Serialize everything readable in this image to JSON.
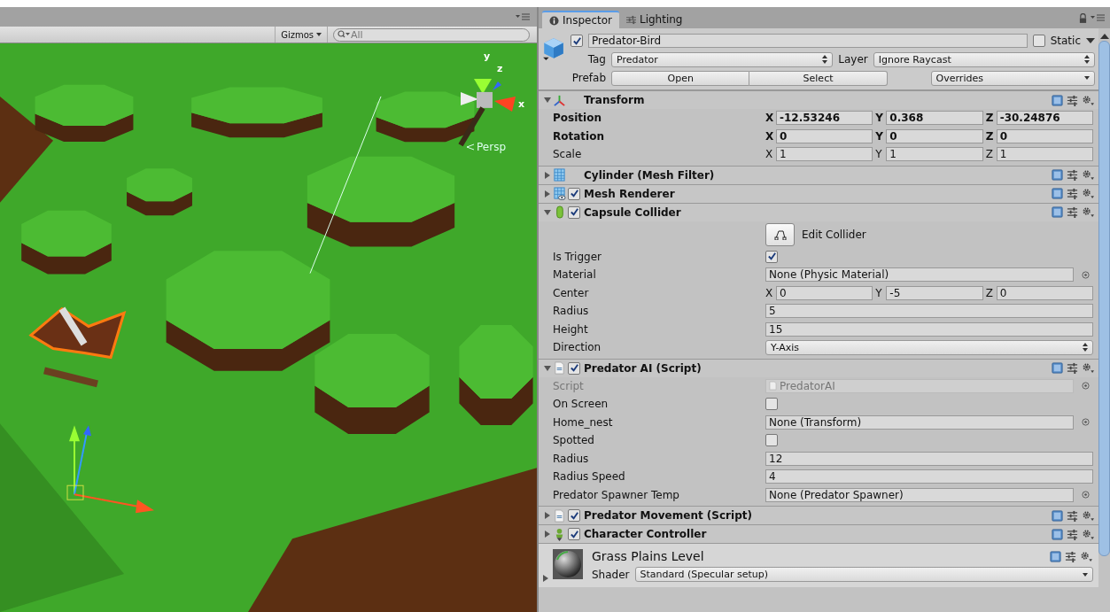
{
  "scene": {
    "gizmos_label": "Gizmos",
    "search_value": "All",
    "axis_labels": [
      "y",
      "z",
      "x"
    ],
    "projection": "Persp"
  },
  "inspector": {
    "tabs": [
      {
        "label": "Inspector",
        "selected": true
      },
      {
        "label": "Lighting",
        "selected": false
      }
    ]
  },
  "object": {
    "active": true,
    "name": "Predator-Bird",
    "static": false,
    "static_label": "Static",
    "tag_label": "Tag",
    "tag": "Predator",
    "layer_label": "Layer",
    "layer": "Ignore Raycast",
    "prefab_label": "Prefab",
    "prefab_buttons": [
      "Open",
      "Select"
    ],
    "overrides": "Overrides"
  },
  "components": [
    {
      "name": "Transform",
      "kind": "transform",
      "expanded": true,
      "rows": [
        {
          "kind": "vector3",
          "label": "Position",
          "modified": true,
          "values": [
            {
              "axis": "X",
              "value": "-12.53246"
            },
            {
              "axis": "Y",
              "value": "0.368"
            },
            {
              "axis": "Z",
              "value": "-30.24876"
            }
          ]
        },
        {
          "kind": "vector3",
          "label": "Rotation",
          "modified": true,
          "values": [
            {
              "axis": "X",
              "value": "0"
            },
            {
              "axis": "Y",
              "value": "0"
            },
            {
              "axis": "Z",
              "value": "0"
            }
          ]
        },
        {
          "kind": "vector3",
          "label": "Scale",
          "modified": false,
          "values": [
            {
              "axis": "X",
              "value": "1"
            },
            {
              "axis": "Y",
              "value": "1"
            },
            {
              "axis": "Z",
              "value": "1"
            }
          ]
        }
      ]
    },
    {
      "name": "Cylinder (Mesh Filter)",
      "kind": "mesh-filter",
      "expanded": false
    },
    {
      "name": "Mesh Renderer",
      "kind": "mesh-renderer",
      "expanded": false,
      "enabled": true
    },
    {
      "name": "Capsule Collider",
      "kind": "capsule",
      "expanded": true,
      "enabled": true,
      "rows": [
        {
          "kind": "button",
          "label": "Edit Collider"
        },
        {
          "kind": "checkbox",
          "label": "Is Trigger",
          "checked": true
        },
        {
          "kind": "object",
          "label": "Material",
          "value": "None (Physic Material)",
          "disabled": false
        },
        {
          "kind": "vector3",
          "label": "Center",
          "modified": false,
          "values": [
            {
              "axis": "X",
              "value": "0"
            },
            {
              "axis": "Y",
              "value": "-5"
            },
            {
              "axis": "Z",
              "value": "0"
            }
          ]
        },
        {
          "kind": "text",
          "label": "Radius",
          "value": "5"
        },
        {
          "kind": "text",
          "label": "Height",
          "value": "15"
        },
        {
          "kind": "dropdown",
          "label": "Direction",
          "value": "Y-Axis"
        }
      ]
    },
    {
      "name": "Predator AI (Script)",
      "kind": "script",
      "expanded": true,
      "enabled": true,
      "rows": [
        {
          "kind": "object",
          "label": "Script",
          "value": "PredatorAI",
          "disabled": true
        },
        {
          "kind": "checkbox",
          "label": "On Screen",
          "checked": false
        },
        {
          "kind": "object",
          "label": "Home_nest",
          "value": "None (Transform)",
          "disabled": false
        },
        {
          "kind": "checkbox",
          "label": "Spotted",
          "checked": false
        },
        {
          "kind": "text",
          "label": "Radius",
          "value": "12"
        },
        {
          "kind": "text",
          "label": "Radius Speed",
          "value": "4"
        },
        {
          "kind": "object",
          "label": "Predator Spawner Temp",
          "value": "None (Predator Spawner)",
          "disabled": false
        }
      ]
    },
    {
      "name": "Predator Movement (Script)",
      "kind": "script",
      "expanded": false,
      "enabled": true
    },
    {
      "name": "Character Controller",
      "kind": "character",
      "expanded": false,
      "enabled": true
    }
  ],
  "material": {
    "name": "Grass Plains Level",
    "shader_label": "Shader",
    "shader": "Standard (Specular setup)"
  }
}
